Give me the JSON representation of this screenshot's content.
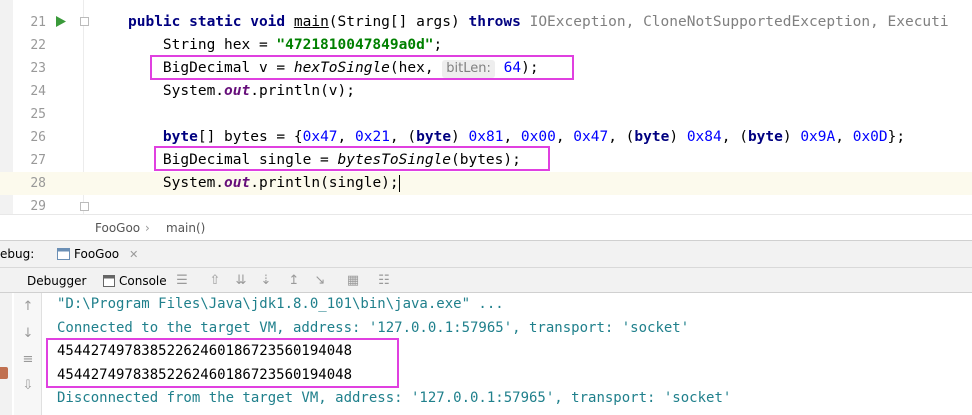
{
  "editor": {
    "lines": [
      {
        "num": "21",
        "parts": [
          {
            "t": "public static void ",
            "c": "kw"
          },
          {
            "t": "main",
            "c": "ul"
          },
          {
            "t": "(String[] args) ",
            "c": ""
          },
          {
            "t": "throws ",
            "c": "kw"
          },
          {
            "t": "IOException, CloneNotSupportedException, Executi",
            "c": "gray"
          }
        ]
      },
      {
        "num": "22",
        "parts": [
          {
            "t": "    String hex = ",
            "c": ""
          },
          {
            "t": "\"4721810047849a0d\"",
            "c": "str"
          },
          {
            "t": ";",
            "c": ""
          }
        ]
      },
      {
        "num": "23",
        "parts": [
          {
            "t": "    BigDecimal v = ",
            "c": ""
          },
          {
            "t": "hexToSingle",
            "c": "it"
          },
          {
            "t": "(hex, ",
            "c": ""
          },
          {
            "t": "bitLen:",
            "c": "hint"
          },
          {
            "t": " 64",
            "c": "num"
          },
          {
            "t": ");",
            "c": ""
          }
        ]
      },
      {
        "num": "24",
        "parts": [
          {
            "t": "    System.",
            "c": ""
          },
          {
            "t": "out",
            "c": "st"
          },
          {
            "t": ".println(v);",
            "c": ""
          }
        ]
      },
      {
        "num": "25",
        "parts": []
      },
      {
        "num": "26",
        "parts": [
          {
            "t": "    ",
            "c": ""
          },
          {
            "t": "byte",
            "c": "kw"
          },
          {
            "t": "[] bytes = {",
            "c": ""
          },
          {
            "t": "0x47",
            "c": "num"
          },
          {
            "t": ", ",
            "c": ""
          },
          {
            "t": "0x21",
            "c": "num"
          },
          {
            "t": ", (",
            "c": ""
          },
          {
            "t": "byte",
            "c": "kw"
          },
          {
            "t": ") ",
            "c": ""
          },
          {
            "t": "0x81",
            "c": "num"
          },
          {
            "t": ", ",
            "c": ""
          },
          {
            "t": "0x00",
            "c": "num"
          },
          {
            "t": ", ",
            "c": ""
          },
          {
            "t": "0x47",
            "c": "num"
          },
          {
            "t": ", (",
            "c": ""
          },
          {
            "t": "byte",
            "c": "kw"
          },
          {
            "t": ") ",
            "c": ""
          },
          {
            "t": "0x84",
            "c": "num"
          },
          {
            "t": ", (",
            "c": ""
          },
          {
            "t": "byte",
            "c": "kw"
          },
          {
            "t": ") ",
            "c": ""
          },
          {
            "t": "0x9A",
            "c": "num"
          },
          {
            "t": ", ",
            "c": ""
          },
          {
            "t": "0x0D",
            "c": "num"
          },
          {
            "t": "};",
            "c": ""
          }
        ]
      },
      {
        "num": "27",
        "parts": [
          {
            "t": "    BigDecimal single = ",
            "c": ""
          },
          {
            "t": "bytesToSingle",
            "c": "it"
          },
          {
            "t": "(bytes);",
            "c": ""
          }
        ]
      },
      {
        "num": "28",
        "parts": [
          {
            "t": "    System.",
            "c": ""
          },
          {
            "t": "out",
            "c": "st"
          },
          {
            "t": ".println(single);",
            "c": ""
          }
        ]
      },
      {
        "num": "29",
        "parts": []
      }
    ]
  },
  "breadcrumb": {
    "class_name": "FooGoo",
    "method_name": "main()"
  },
  "debug": {
    "title_fragment": "ebug:",
    "session_tab": "FooGoo",
    "tabs": {
      "debugger": "Debugger",
      "console": "Console"
    }
  },
  "console": {
    "lines": [
      {
        "text": "\"D:\\Program Files\\Java\\jdk1.8.0_101\\bin\\java.exe\" ...",
        "color": "#20808c"
      },
      {
        "text": "Connected to the target VM, address: '127.0.0.1:57965', transport: 'socket'",
        "color": "#20808c"
      },
      {
        "text": "45442749783852262460186723560194048",
        "color": "#000000"
      },
      {
        "text": "45442749783852262460186723560194048",
        "color": "#000000"
      },
      {
        "text": "Disconnected from the target VM, address: '127.0.0.1:57965', transport: 'socket'",
        "color": "#20808c"
      }
    ]
  },
  "colors": {
    "highlight_box": "#e040e0",
    "run_icon": "#3a9a3a",
    "console_link": "#20808c"
  }
}
